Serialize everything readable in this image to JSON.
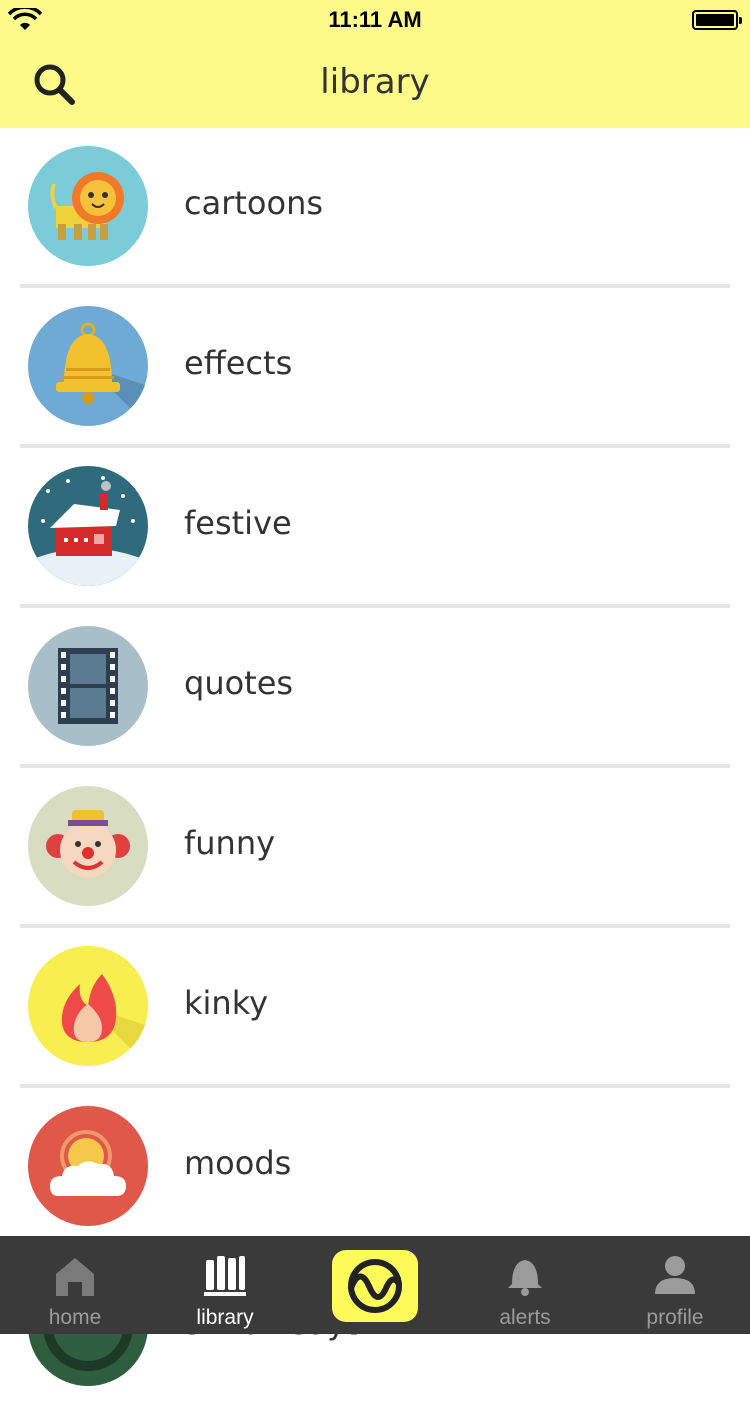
{
  "status_bar": {
    "time": "11:11 AM"
  },
  "header": {
    "title": "library",
    "search_icon": "search-icon"
  },
  "colors": {
    "header_bg": "#fdfa8a",
    "tabbar_bg": "#3a3a3a",
    "accent": "#fdfa5a"
  },
  "categories": [
    {
      "label": "cartoons",
      "icon": "lion-icon"
    },
    {
      "label": "effects",
      "icon": "bell-icon"
    },
    {
      "label": "festive",
      "icon": "snow-house-icon"
    },
    {
      "label": "quotes",
      "icon": "film-strip-icon"
    },
    {
      "label": "funny",
      "icon": "clown-icon"
    },
    {
      "label": "kinky",
      "icon": "flame-icon"
    },
    {
      "label": "moods",
      "icon": "sun-cloud-icon"
    },
    {
      "label": "simon says",
      "icon": "partial-icon"
    }
  ],
  "tabbar": {
    "tabs": [
      {
        "label": "home",
        "icon": "house-icon"
      },
      {
        "label": "library",
        "icon": "books-icon",
        "active": true
      },
      {
        "label": "",
        "icon": "waveform-icon"
      },
      {
        "label": "alerts",
        "icon": "bell-icon"
      },
      {
        "label": "profile",
        "icon": "person-icon"
      }
    ]
  }
}
